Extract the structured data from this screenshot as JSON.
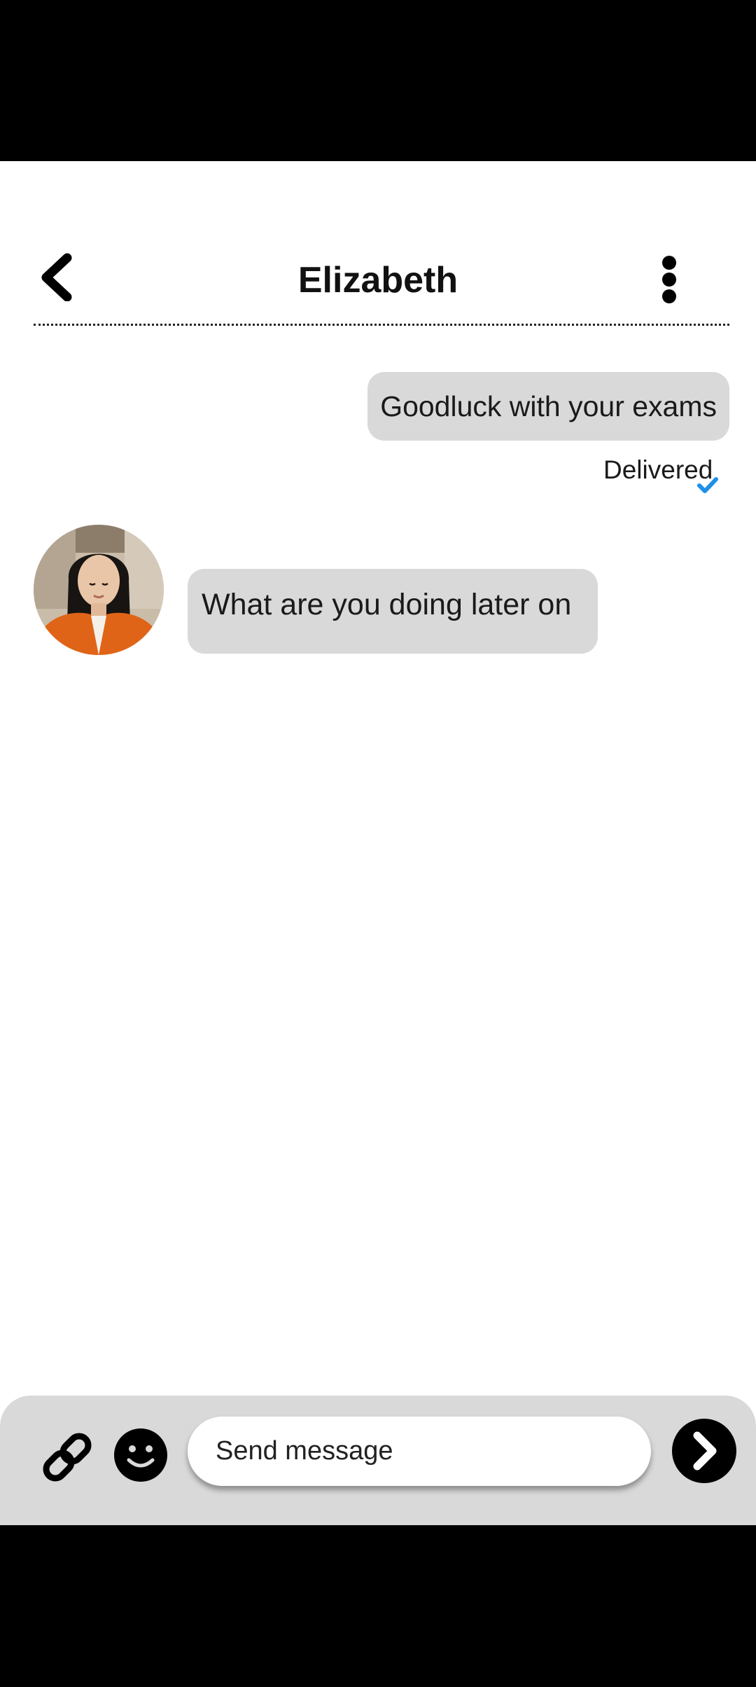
{
  "header": {
    "title": "Elizabeth",
    "back_icon": "chevron-left-icon",
    "menu_icon": "more-vertical-icon"
  },
  "messages": [
    {
      "direction": "outgoing",
      "text": "Goodluck with your exams",
      "status": "Delivered",
      "status_icon": "check-icon"
    },
    {
      "direction": "incoming",
      "text": "What are you doing later on",
      "avatar": "avatar-photo"
    }
  ],
  "composer": {
    "placeholder": "Send message",
    "attach_icon": "link-icon",
    "emoji_icon": "smiley-icon",
    "send_icon": "chevron-right-icon"
  },
  "colors": {
    "bubble": "#d9d9d9",
    "check": "#1e90e8",
    "composer_bg": "#d9d9d9",
    "send_button": "#000000"
  }
}
